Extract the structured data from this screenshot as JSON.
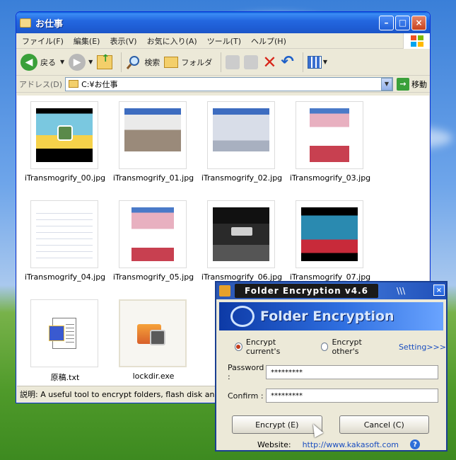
{
  "explorer": {
    "title": "お仕事",
    "menu": [
      "ファイル(F)",
      "編集(E)",
      "表示(V)",
      "お気に入り(A)",
      "ツール(T)",
      "ヘルプ(H)"
    ],
    "toolbar": {
      "back": "戻る",
      "search": "検索",
      "folders": "フォルダ"
    },
    "address_label": "アドレス(D)",
    "address_value": "C:¥お仕事",
    "go_label": "移動",
    "files": [
      "iTransmogrify_00.jpg",
      "iTransmogrify_01.jpg",
      "iTransmogrify_02.jpg",
      "iTransmogrify_03.jpg",
      "iTransmogrify_04.jpg",
      "iTransmogrify_05.jpg",
      "iTransmogrify_06.jpg",
      "iTransmogrify_07.jpg",
      "原稿.txt",
      "lockdir.exe"
    ],
    "status": "説明: A useful tool to encrypt folders, flash disk and H"
  },
  "dialog": {
    "title": "Folder Encryption v4.6",
    "stripes": "\\\\\\",
    "banner": "Folder Encryption",
    "option_current": "Encrypt current's",
    "option_other": "Encrypt other's",
    "setting_link": "Setting>>>",
    "password_label": "Password :",
    "password_value": "*********",
    "confirm_label": "Confirm :",
    "confirm_value": "*********",
    "encrypt_button": "Encrypt (E)",
    "cancel_button": "Cancel (C)",
    "website_label": "Website:",
    "website_url": "http://www.kakasoft.com"
  }
}
